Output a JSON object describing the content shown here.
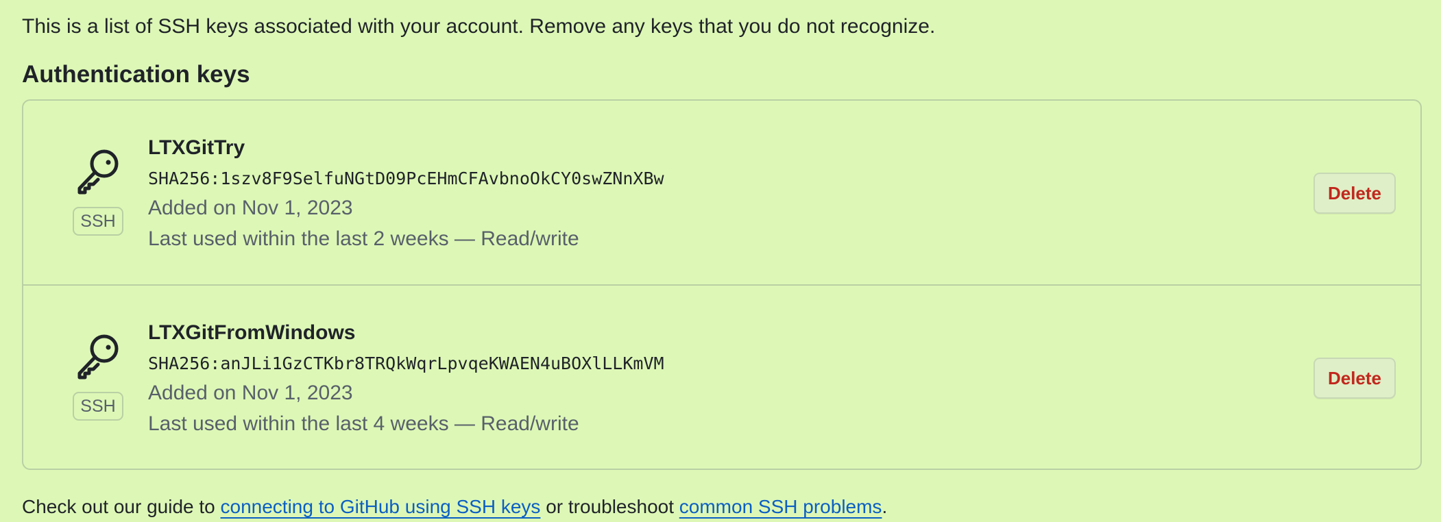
{
  "intro_text": "This is a list of SSH keys associated with your account. Remove any keys that you do not recognize.",
  "section_title": "Authentication keys",
  "keys": [
    {
      "name": "LTXGitTry",
      "fingerprint": "SHA256:1szv8F9SelfuNGtD09PcEHmCFAvbnoOkCY0swZNnXBw",
      "added": "Added on Nov 1, 2023",
      "last_used": "Last used within the last 2 weeks — Read/write",
      "badge": "SSH",
      "icon": "key-icon",
      "delete_label": "Delete"
    },
    {
      "name": "LTXGitFromWindows",
      "fingerprint": "SHA256:anJLi1GzCTKbr8TRQkWqrLpvqeKWAEN4uBOXlLLKmVM",
      "added": "Added on Nov 1, 2023",
      "last_used": "Last used within the last 4 weeks — Read/write",
      "badge": "SSH",
      "icon": "key-icon",
      "delete_label": "Delete"
    }
  ],
  "footer": {
    "prefix": "Check out our guide to ",
    "link1": "connecting to GitHub using SSH keys",
    "middle": " or troubleshoot ",
    "link2": "common SSH problems",
    "suffix": "."
  },
  "colors": {
    "background": "#ddf7b6",
    "danger": "#c1271d",
    "link": "#0b5fc3",
    "muted": "#57606a"
  }
}
